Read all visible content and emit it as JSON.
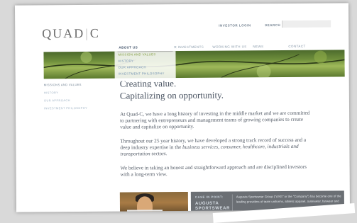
{
  "logo": {
    "left": "QUAD",
    "bar": "|",
    "right": "C"
  },
  "utility": {
    "investor_login": "INVESTOR LOGIN",
    "search": "SEARCH"
  },
  "nav": [
    {
      "label": "ABOUT US",
      "active": true
    },
    {
      "label": "R INVESTMENTS",
      "active": false
    },
    {
      "label": "WORKING WITH US",
      "active": false
    },
    {
      "label": "NEWS",
      "active": false
    },
    {
      "label": "CONTACT",
      "active": false
    }
  ],
  "dropdown": [
    "MISSION AND VALUES",
    "HISTORY",
    "OUR APPROACH",
    "INVESTMENT PHILOSOPHY"
  ],
  "sidebar": [
    "MISSIONS AND VALUES",
    "HISTORY",
    "OUR APPROACH",
    "INVESTMENT PHILOSOPHY"
  ],
  "main": {
    "heading_cut": "Creating value.",
    "heading": "Capitalizing on opportunity.",
    "para1": "At Quad-C, we have a long history of investing in the middle market and we are committed to partnering with entrepreneurs and management teams of growing companies to create value and capitalize on opportunity.",
    "para2_start": "Throughout our 25 year history, we have developed a strong track record of success and a deep industry expertise in the ",
    "para2_em1": "business services, consumer, healthcare, industrials and transportation",
    "para2_end": " sectors.",
    "para3": "We believe in taking an honest and straightforward approach and are disciplined investors with a long-term view."
  },
  "case_study": {
    "label": "CASE IN POINT:",
    "title": "AUGUSTA SPORTSWEAR",
    "desc": "Augusta Sportswear Group (\"ASG\" or the \"Company\") has become one of the leading providers of team uniforms, athletic apparel, outerwear, fanwear and"
  }
}
